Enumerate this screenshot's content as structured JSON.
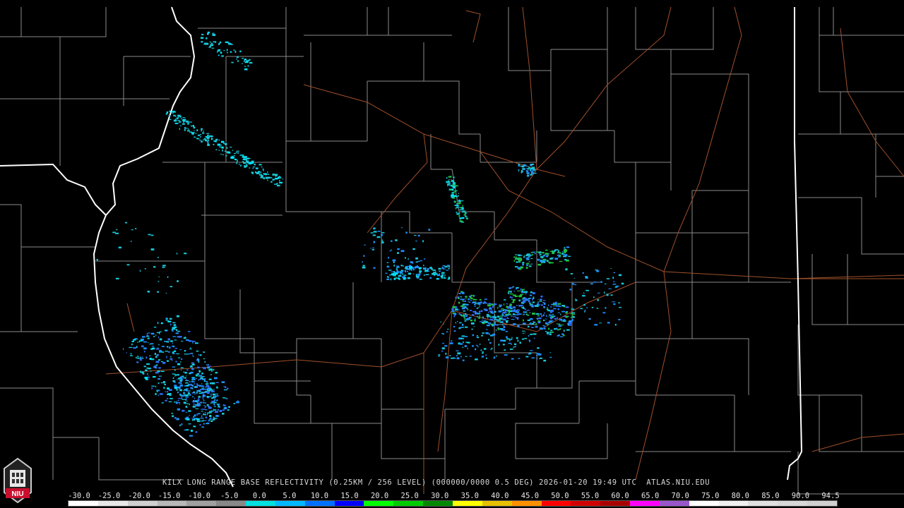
{
  "product": {
    "caption": "KILX LONG RANGE BASE REFLECTIVITY (0.25KM / 256 LEVEL) (000000/0000 0.5 DEG) 2026-01-20 19:49 UTC  ATLAS.NIU.EDU",
    "logo_text": "NIU"
  },
  "scale": {
    "ticks": [
      "-30.0",
      "-25.0",
      "-20.0",
      "-15.0",
      "-10.0",
      "-5.0",
      "0.0",
      "5.0",
      "10.0",
      "15.0",
      "20.0",
      "25.0",
      "30.0",
      "35.0",
      "40.0",
      "45.0",
      "50.0",
      "55.0",
      "60.0",
      "65.0",
      "70.0",
      "75.0",
      "80.0",
      "85.0",
      "90.0",
      "94.5"
    ],
    "colors": [
      "#ffffff",
      "#e8e8e8",
      "#d0d0d0",
      "#b8b8b8",
      "#a0a0a0",
      "#888888",
      "#00e0e0",
      "#00b8ff",
      "#0070ff",
      "#0000ff",
      "#00ff00",
      "#00cc00",
      "#008800",
      "#ffff00",
      "#e8c000",
      "#ff9000",
      "#ff0000",
      "#d00000",
      "#a80000",
      "#ff00ff",
      "#9955cc",
      "#ffffff",
      "#f0f0f0",
      "#e0e0e0",
      "#d8d8d8",
      "#d0d0d0"
    ]
  },
  "map": {
    "state_line_color": "#ffffff",
    "county_line_color": "#8a8a8a",
    "highway_color": "#a0502a",
    "echo_colors": [
      "#18c8d8",
      "#1e90ff",
      "#3070ff",
      "#20c040",
      "#00e8ff"
    ]
  }
}
